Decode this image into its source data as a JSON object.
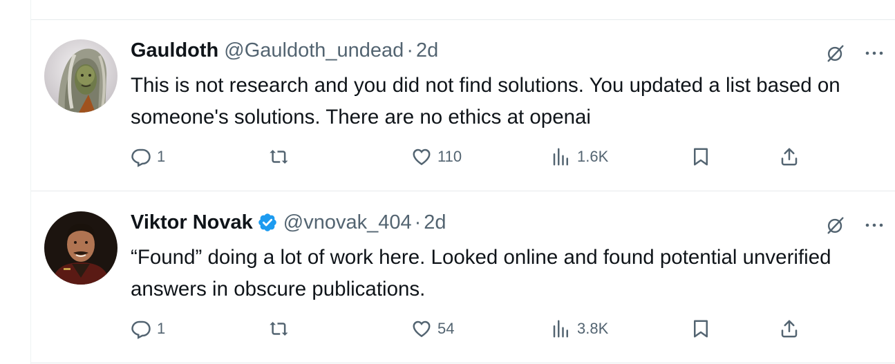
{
  "tweets": [
    {
      "display_name": "Gauldoth",
      "verified": false,
      "handle": "@Gauldoth_undead",
      "separator": "·",
      "time": "2d",
      "text": "This is not research and you did not find solutions. You updated a list based on someone's solutions. There are no ethics at openai",
      "replies": "1",
      "retweets": "",
      "likes": "110",
      "views": "1.6K",
      "avatar_icon": "hooded-figure-avatar"
    },
    {
      "display_name": "Viktor Novak",
      "verified": true,
      "handle": "@vnovak_404",
      "separator": "·",
      "time": "2d",
      "text": "“Found” doing a lot of work here. Looked online and found potential unverified answers in obscure publications.",
      "replies": "1",
      "retweets": "",
      "likes": "54",
      "views": "3.8K",
      "avatar_icon": "man-portrait-avatar"
    }
  ],
  "colors": {
    "text_primary": "#0f1419",
    "text_secondary": "#536471",
    "verified_blue": "#1d9bf0",
    "divider": "#e6eaec"
  }
}
